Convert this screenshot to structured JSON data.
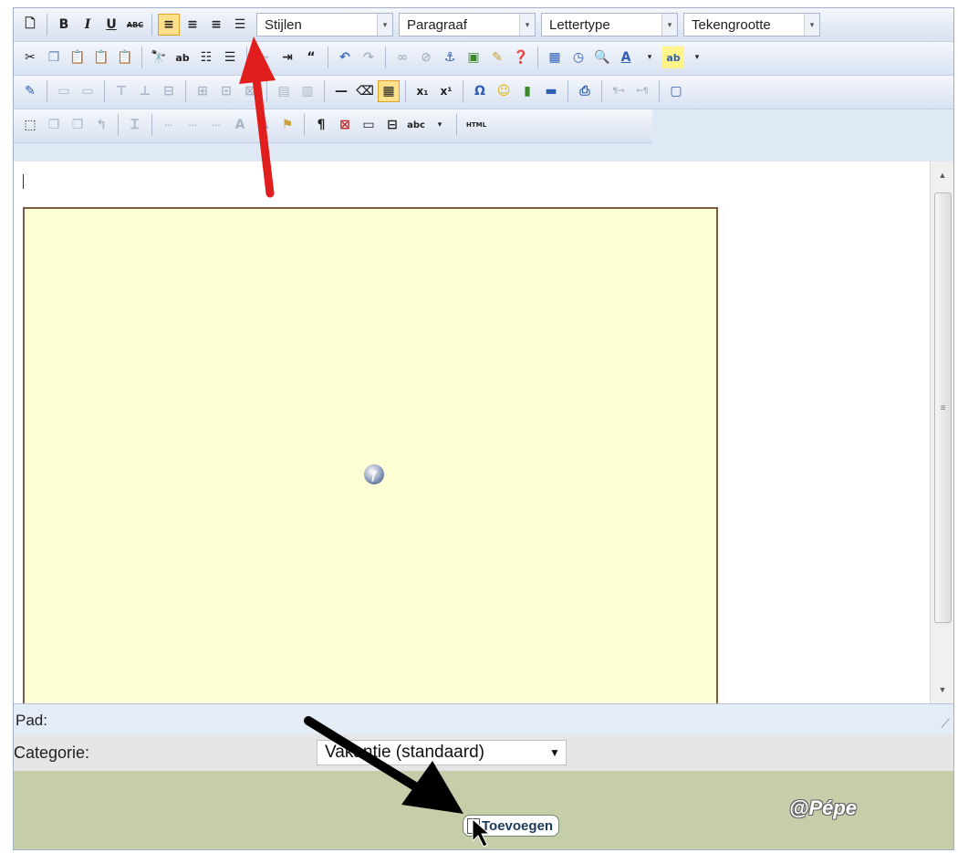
{
  "toolbar": {
    "row1": {
      "styles_combo": "Stijlen",
      "paragraph_combo": "Paragraaf",
      "font_combo": "Lettertype",
      "fontsize_combo": "Tekengrootte",
      "bold": "B",
      "italic": "I",
      "underline": "U",
      "strike": "ABC"
    },
    "row3": {
      "subscript": "x₁",
      "superscript": "x¹",
      "omega": "Ω"
    },
    "row4": {
      "pilcrow": "¶",
      "html": "HTML"
    },
    "accent_color": "#ffe08a"
  },
  "statusbar": {
    "path_label": "Pad:"
  },
  "category": {
    "label": "Categorie:",
    "selected": "Vakantie (standaard)"
  },
  "actions": {
    "add_label": "Toevoegen"
  },
  "watermark": "@Pépe",
  "colors": {
    "flash_box_bg": "#ffffd6",
    "bottom_bg": "#c5cea9",
    "arrow_red": "#e01e1e",
    "arrow_black": "#000000"
  }
}
